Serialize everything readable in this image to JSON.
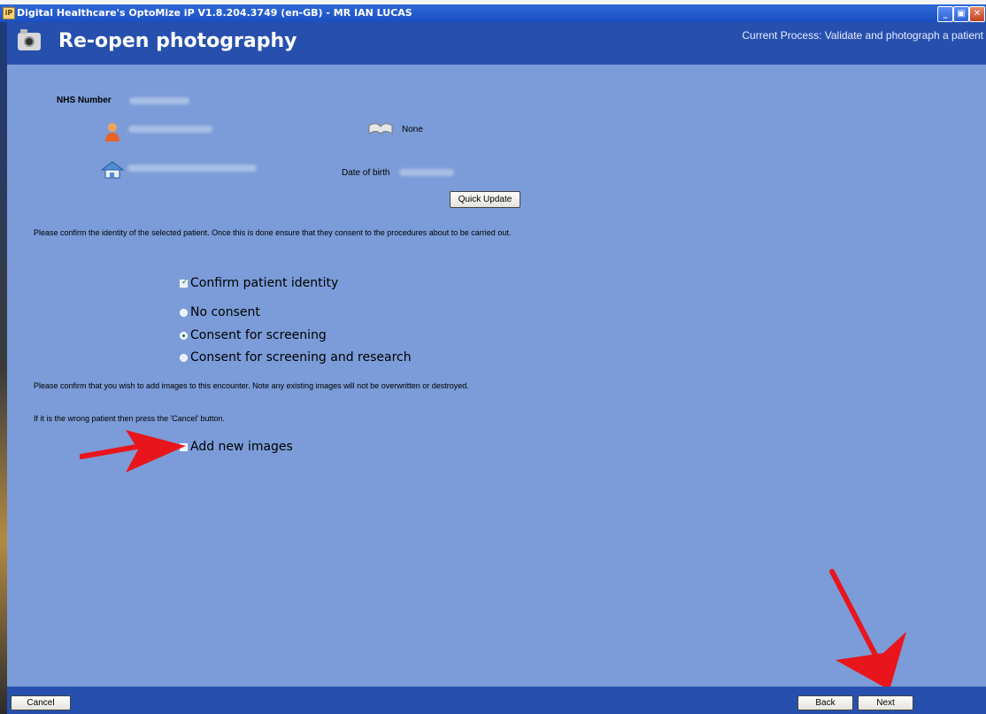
{
  "window": {
    "title": "Digital Healthcare's OptoMize iP V1.8.204.3749 (en-GB) - MR IAN LUCAS",
    "minimize": "_",
    "restore": "▣",
    "close": "✕"
  },
  "header": {
    "heading": "Re-open photography",
    "current_process": "Current Process: Validate and photograph a patient"
  },
  "patient": {
    "nhs_label": "NHS Number",
    "notes_value": "None",
    "dob_label": "Date of birth"
  },
  "quick_update_label": "Quick Update",
  "instructions": {
    "identity": "Please confirm the identity of the selected patient. Once this is done ensure that they consent to the procedures about to be carried out.",
    "images": "Please confirm that you wish to add images to this encounter. Note any existing images will not be overwritten or destroyed.",
    "wrong_patient": "If it is the wrong patient then press the 'Cancel' button."
  },
  "options": {
    "confirm_identity": {
      "label": "Confirm patient identity",
      "checked": true
    },
    "consent": [
      {
        "label": "No consent",
        "selected": false
      },
      {
        "label": "Consent for screening",
        "selected": true
      },
      {
        "label": "Consent for screening and research",
        "selected": false
      }
    ],
    "add_images": {
      "label": "Add new images",
      "checked": false
    }
  },
  "footer": {
    "cancel": "Cancel",
    "back": "Back",
    "next": "Next"
  },
  "colors": {
    "background": "#7b9cd8",
    "header_bar": "#2750ae",
    "annotation_arrow": "#e8161c"
  }
}
